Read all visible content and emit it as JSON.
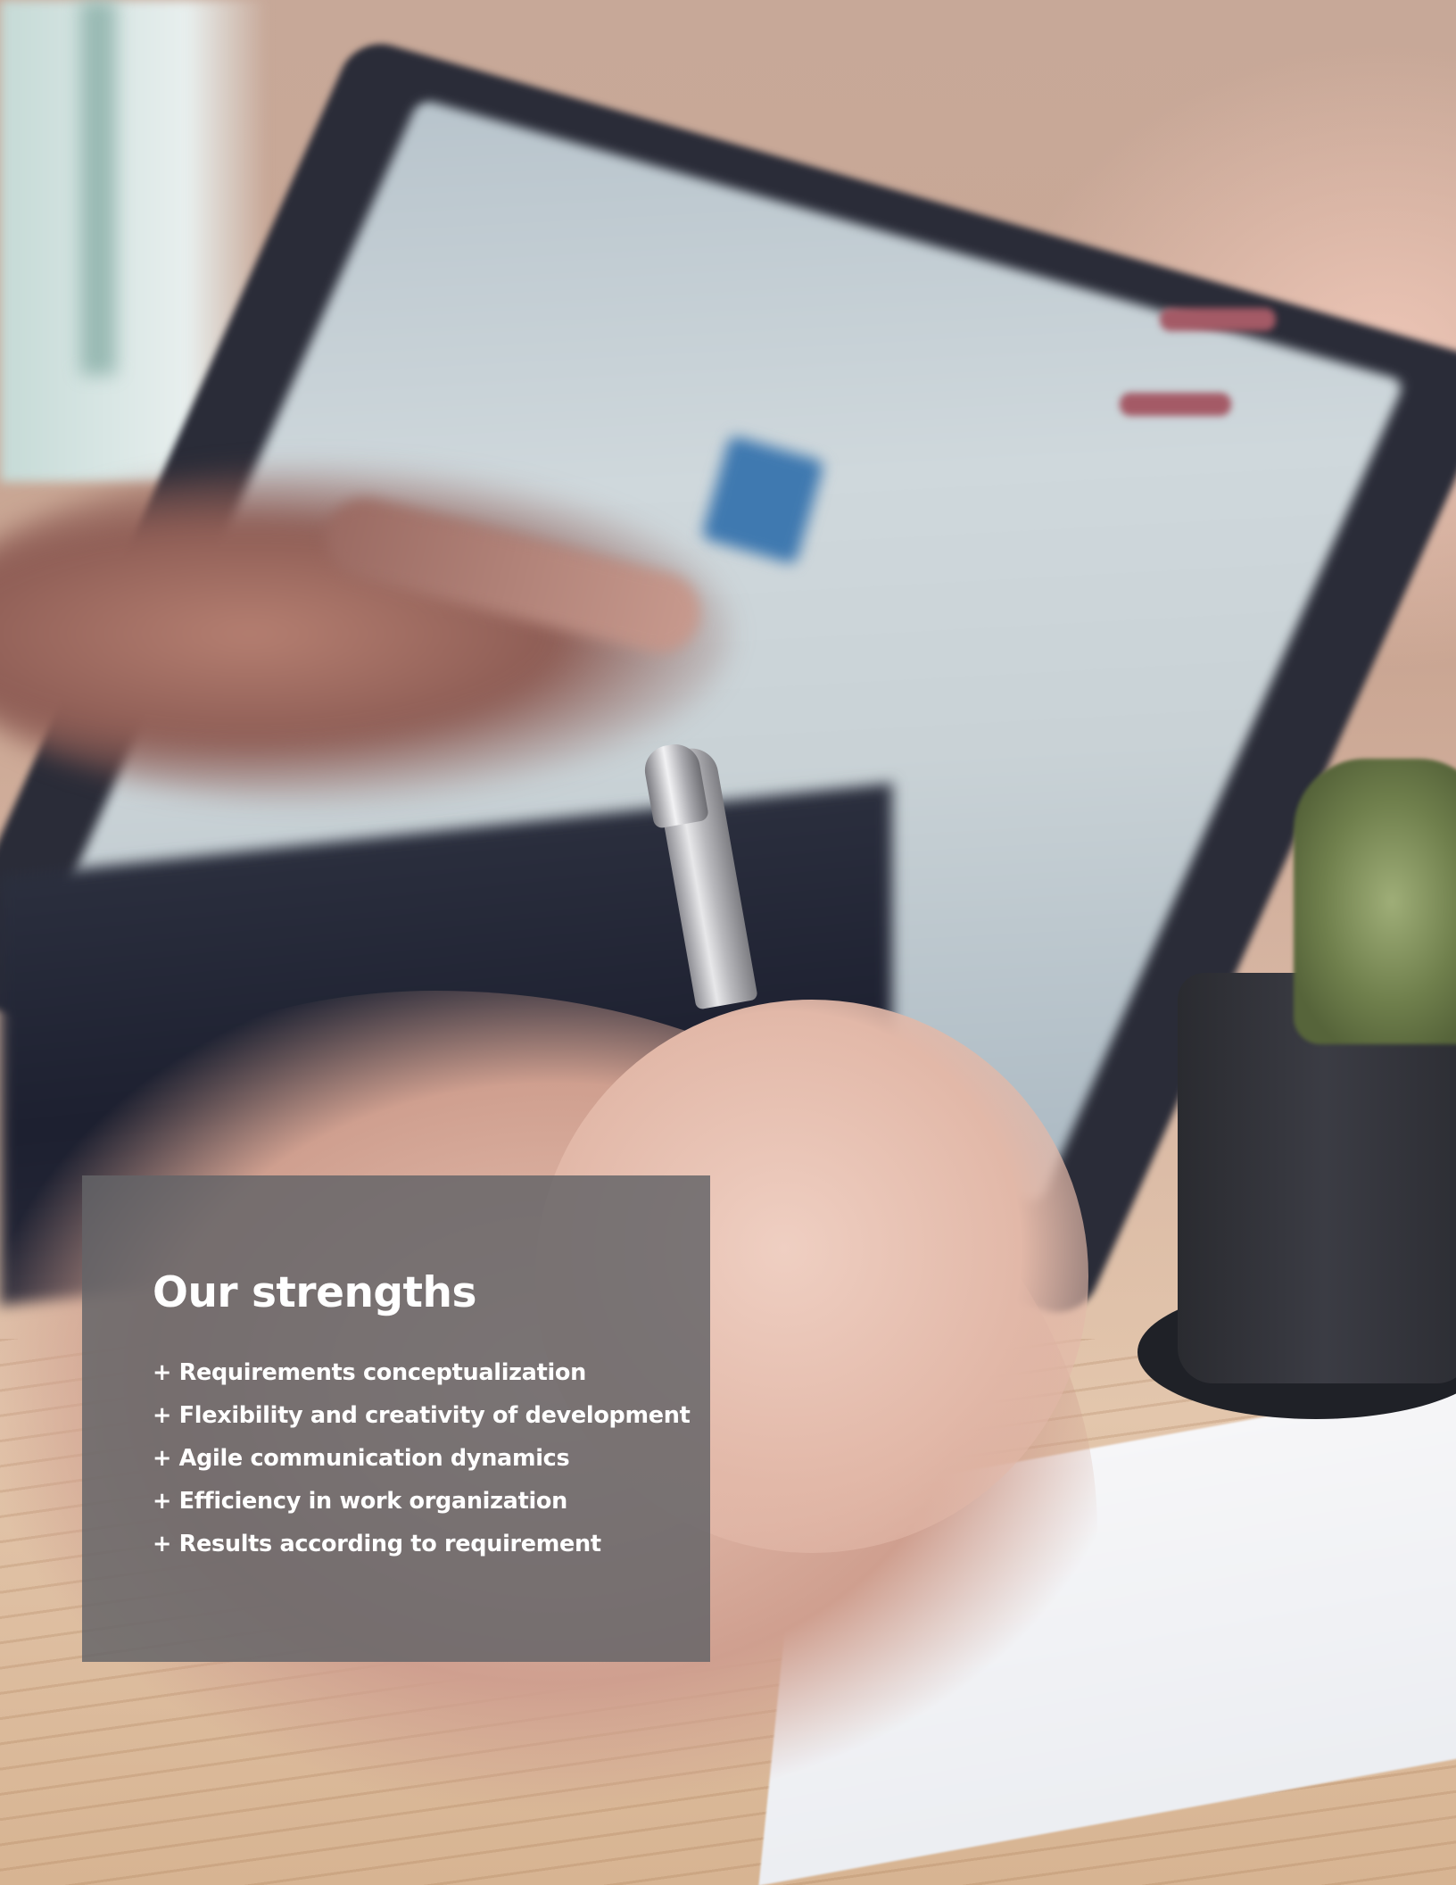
{
  "card": {
    "title": "Our strengths",
    "items": [
      "+ Requirements conceptualization",
      "+ Flexibility and creativity of development",
      "+ Agile communication dynamics",
      "+ Efficiency in work organization",
      "+ Results according to requirement"
    ]
  },
  "colors": {
    "card_background": "#646468",
    "text": "#ffffff"
  }
}
